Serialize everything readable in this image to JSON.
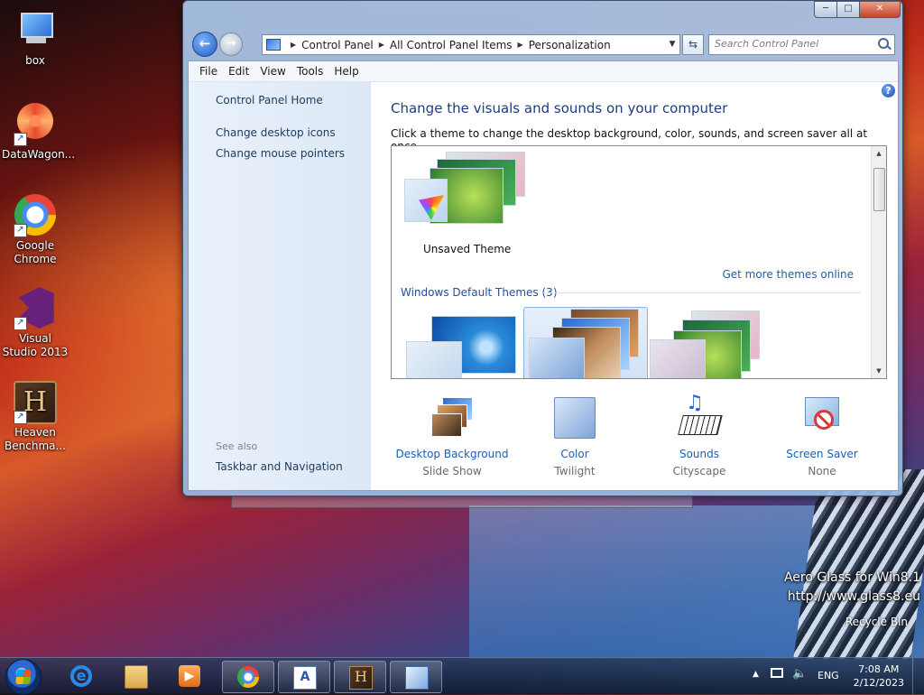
{
  "desktop": {
    "icons": [
      {
        "label": "box",
        "icon": "computer-icon"
      },
      {
        "label": "DataWagon...",
        "icon": "datawagon-icon"
      },
      {
        "label": "Google Chrome",
        "icon": "chrome-icon"
      },
      {
        "label": "Visual Studio 2013",
        "icon": "visual-studio-icon"
      },
      {
        "label": "Heaven Benchma...",
        "icon": "heaven-benchmark-icon"
      }
    ],
    "watermark_line1": "Aero Glass for Win8.1",
    "watermark_line2": "http://www.glass8.eu",
    "recycle_label": "Recycle Bin"
  },
  "window": {
    "breadcrumbs": [
      "Control Panel",
      "All Control Panel Items",
      "Personalization"
    ],
    "search_placeholder": "Search Control Panel",
    "menu": [
      "File",
      "Edit",
      "View",
      "Tools",
      "Help"
    ],
    "left_pane": {
      "home": "Control Panel Home",
      "links": [
        "Change desktop icons",
        "Change mouse pointers"
      ],
      "see_also": "See also",
      "see_also_links": [
        "Taskbar and Navigation"
      ]
    },
    "main": {
      "title": "Change the visuals and sounds on your computer",
      "description": "Click a theme to change the desktop background, color, sounds, and screen saver all at once.",
      "unsaved_theme": "Unsaved Theme",
      "get_more": "Get more themes online",
      "default_themes_heading": "Windows Default Themes (3)"
    },
    "bottom": [
      {
        "title": "Desktop Background",
        "sub": "Slide Show",
        "icon": "desktop-background-icon"
      },
      {
        "title": "Color",
        "sub": "Twilight",
        "icon": "color-icon"
      },
      {
        "title": "Sounds",
        "sub": "Cityscape",
        "icon": "sounds-icon"
      },
      {
        "title": "Screen Saver",
        "sub": "None",
        "icon": "screen-saver-icon"
      }
    ]
  },
  "taskbar": {
    "pinned": [
      "internet-explorer-icon",
      "file-explorer-icon",
      "media-player-icon",
      "chrome-icon",
      "wordpad-icon",
      "heaven-benchmark-icon",
      "control-panel-icon"
    ],
    "language": "ENG",
    "time": "7:08 AM",
    "date": "2/12/2023"
  },
  "colors": {
    "link_blue": "#1e5eaa",
    "title_blue": "#1e3c80",
    "left_pane_bg": "#e4eef9"
  }
}
